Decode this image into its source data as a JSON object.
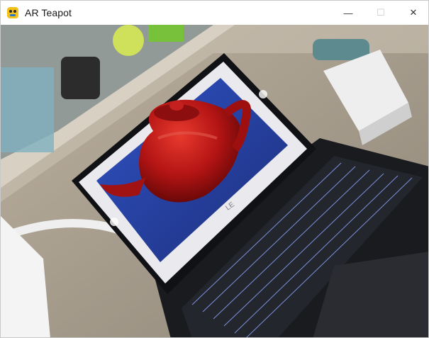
{
  "window": {
    "title": "AR Teapot",
    "icon": "pygame-snake-icon",
    "controls": [
      {
        "name": "minimize-button",
        "glyph": "—",
        "enabled": true
      },
      {
        "name": "maximize-button",
        "glyph": "☐",
        "enabled": false
      },
      {
        "name": "close-button",
        "glyph": "✕",
        "enabled": true
      }
    ]
  },
  "scene": {
    "description_icon": "camera-feed",
    "laptop_brand_mark": "LE",
    "object": "teapot",
    "object_color": "#b31414"
  }
}
